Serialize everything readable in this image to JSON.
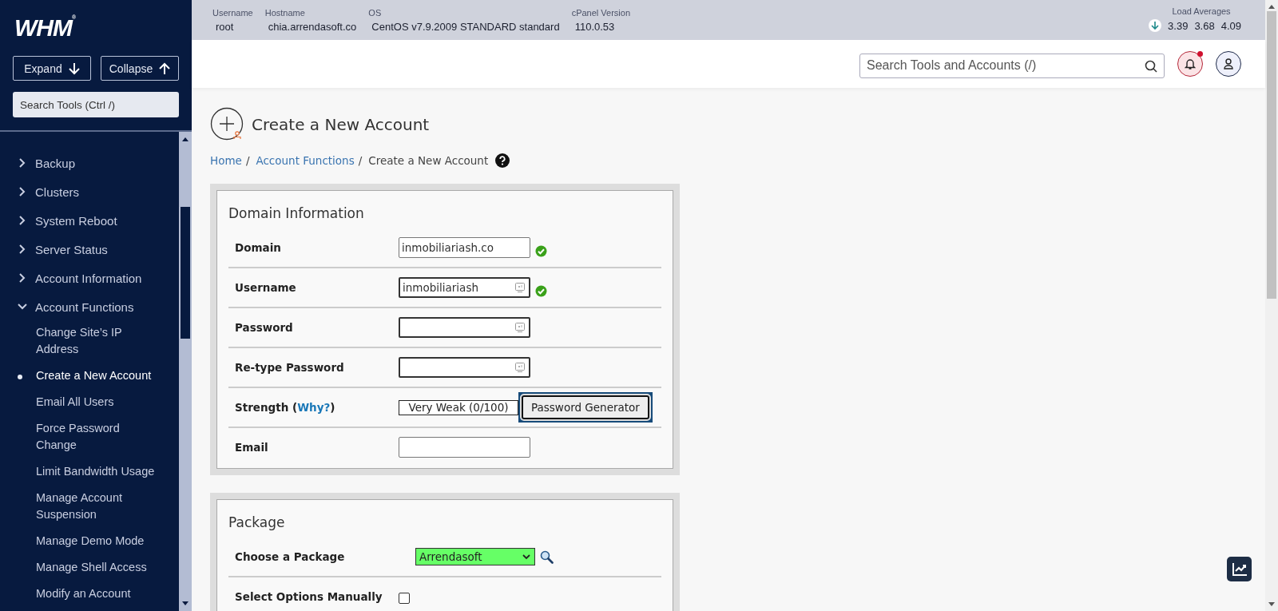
{
  "sidebar": {
    "logo": "WHM$^{®}$",
    "buttons": [
      {
        "label": "Expand",
        "kind": "expand"
      },
      {
        "label": "Collapse",
        "kind": "collapse"
      }
    ],
    "search": {
      "placeholder": "Search Tools (Ctrl /)"
    },
    "items": [
      {
        "label": "Backup",
        "expanded": false
      },
      {
        "label": "Clusters",
        "expanded": false
      },
      {
        "label": "System Reboot",
        "expanded": false
      },
      {
        "label": "Server Status",
        "expanded": false
      },
      {
        "label": "Account Information",
        "expanded": false
      },
      {
        "label": "Account Functions",
        "expanded": true,
        "children": [
          {
            "label": "Change Site’s IP Address",
            "selected": false
          },
          {
            "label": "Create a New Account",
            "selected": true
          },
          {
            "label": "Email All Users",
            "selected": false
          },
          {
            "label": "Force Password Change",
            "selected": false
          },
          {
            "label": "Limit Bandwidth Usage",
            "selected": false
          },
          {
            "label": "Manage Account Suspension",
            "selected": false
          },
          {
            "label": "Manage Demo Mode",
            "selected": false
          },
          {
            "label": "Manage Shell Access",
            "selected": false
          },
          {
            "label": "Modify an Account",
            "selected": false
          }
        ]
      }
    ]
  },
  "header": {
    "stats": [
      {
        "label": "Username",
        "value": "root"
      },
      {
        "label": "Hostname",
        "value": "chia.arrendasoft.co"
      },
      {
        "label": "OS",
        "value": "CentOS v7.9.2009 STANDARD standard"
      },
      {
        "label": "cPanel Version",
        "value": "110.0.53"
      }
    ],
    "load_averages": {
      "label": "Load Averages",
      "values": [
        "3.39",
        "3.68",
        "4.09"
      ]
    },
    "search": {
      "placeholder": "Search Tools and Accounts (/)"
    },
    "notifications": {
      "unread": true
    }
  },
  "page": {
    "title": "Create a New Account",
    "breadcrumb": [
      {
        "label": "Home",
        "link": true,
        "separator": "/"
      },
      {
        "label": "Account Functions",
        "link": true,
        "separator": "/"
      },
      {
        "label": "Create a New Account",
        "link": false
      }
    ]
  },
  "sections": [
    {
      "title": "Domain Information",
      "rows": [
        {
          "kind": "text",
          "label": "Domain",
          "value": "inmobiliariash.co",
          "valid": true
        },
        {
          "kind": "secure",
          "label": "Username",
          "value": "inmobiliariash",
          "valid": true
        },
        {
          "kind": "secure",
          "label": "Password",
          "valid": false
        },
        {
          "kind": "secure",
          "label": "Re-type Password",
          "valid": false
        },
        {
          "kind": "strength",
          "label": "Strength (",
          "link": "Why?",
          "label_end": ")",
          "meter": {
            "text": "Very Weak (0/100)",
            "level": 0
          },
          "button": {
            "label": "Password Generator",
            "focused": true
          }
        },
        {
          "kind": "text",
          "label": "Email",
          "valid": false
        }
      ]
    },
    {
      "title": "Package",
      "rows": [
        {
          "kind": "select",
          "label": "Choose a Package",
          "value": "Arrendasoft"
        },
        {
          "kind": "checkbox",
          "label": "Select Options Manually",
          "checked": false
        }
      ]
    }
  ]
}
